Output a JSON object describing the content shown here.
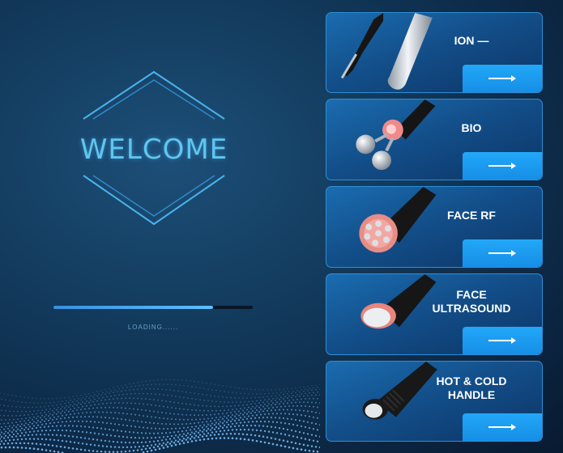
{
  "welcome": {
    "title": "WELCOME",
    "loading_label": "LOADING......",
    "progress": 0.8
  },
  "handles": [
    {
      "label": "ION —",
      "art": "ion-probe-icon"
    },
    {
      "label": "BIO",
      "art": "bio-roller-icon"
    },
    {
      "label": "FACE RF",
      "art": "rf-handle-icon"
    },
    {
      "label": "FACE\nULTRASOUND",
      "art": "ultrasound-handle-icon"
    },
    {
      "label": "HOT & COLD\nHANDLE",
      "art": "hot-cold-handle-icon"
    }
  ],
  "colors": {
    "accent": "#1f9cf0",
    "title": "#5fc6f0",
    "card_border": "#2e8fd6"
  }
}
